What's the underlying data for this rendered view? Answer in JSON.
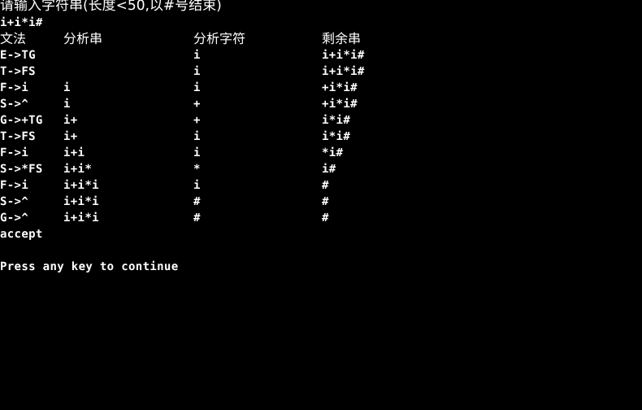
{
  "terminal": {
    "background_color": "#000000",
    "text_color": "#ffffff",
    "prompt": "请输入字符串(长度<50,以#号结束)",
    "input_echo": "i+i*i#",
    "headers": {
      "grammar": "文法",
      "analysis_string": "分析串",
      "analysis_char": "分析字符",
      "remaining_string": "剩余串"
    },
    "rows": [
      {
        "grammar": "E->TG",
        "analysis_string": "",
        "analysis_char": "i",
        "remaining_string": "i+i*i#"
      },
      {
        "grammar": "T->FS",
        "analysis_string": "",
        "analysis_char": "i",
        "remaining_string": "i+i*i#"
      },
      {
        "grammar": "F->i",
        "analysis_string": "i",
        "analysis_char": "i",
        "remaining_string": "+i*i#"
      },
      {
        "grammar": "S->^",
        "analysis_string": "i",
        "analysis_char": "+",
        "remaining_string": "+i*i#"
      },
      {
        "grammar": "G->+TG",
        "analysis_string": "i+",
        "analysis_char": "+",
        "remaining_string": "i*i#"
      },
      {
        "grammar": "T->FS",
        "analysis_string": "i+",
        "analysis_char": "i",
        "remaining_string": "i*i#"
      },
      {
        "grammar": "F->i",
        "analysis_string": "i+i",
        "analysis_char": "i",
        "remaining_string": "*i#"
      },
      {
        "grammar": "S->*FS",
        "analysis_string": "i+i*",
        "analysis_char": "*",
        "remaining_string": "i#"
      },
      {
        "grammar": "F->i",
        "analysis_string": "i+i*i",
        "analysis_char": "i",
        "remaining_string": "#"
      },
      {
        "grammar": "S->^",
        "analysis_string": "i+i*i",
        "analysis_char": "#",
        "remaining_string": "#"
      },
      {
        "grammar": "G->^",
        "analysis_string": "i+i*i",
        "analysis_char": "#",
        "remaining_string": "#"
      }
    ],
    "result": "accept",
    "press_any_key": "Press any key to continue"
  }
}
